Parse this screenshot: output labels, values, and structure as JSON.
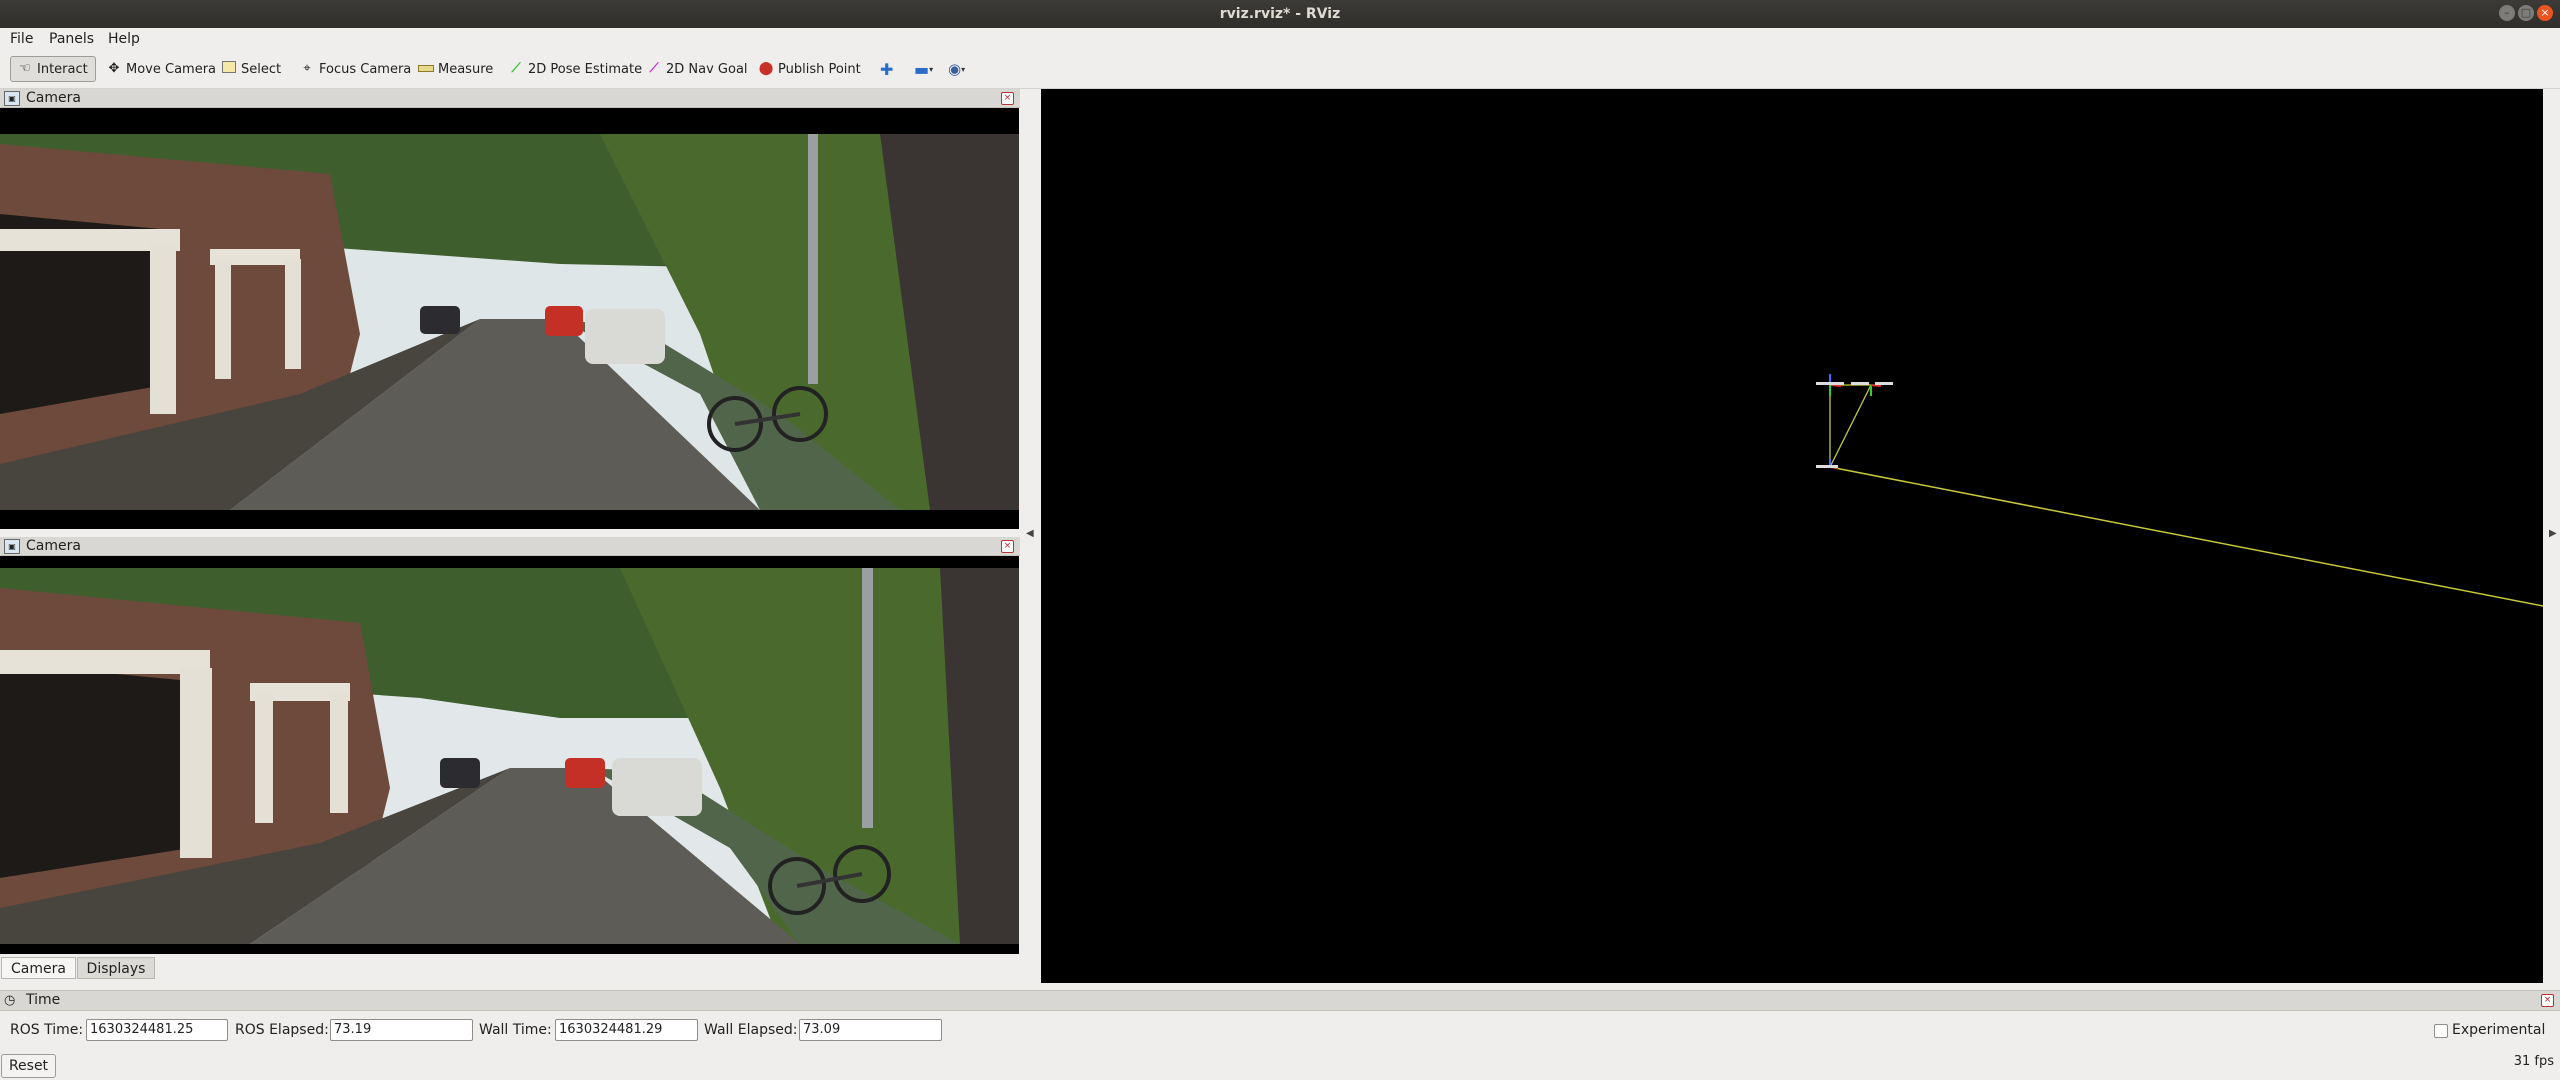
{
  "window": {
    "title": "rviz.rviz* - RViz"
  },
  "menubar": {
    "file": "File",
    "panels": "Panels",
    "help": "Help"
  },
  "toolbar": {
    "interact": "Interact",
    "move_camera": "Move Camera",
    "select": "Select",
    "focus_camera": "Focus Camera",
    "measure": "Measure",
    "pose_estimate": "2D Pose Estimate",
    "nav_goal": "2D Nav Goal",
    "publish_point": "Publish Point"
  },
  "panels": {
    "camera_top_title": "Camera",
    "camera_bottom_title": "Camera"
  },
  "tabs": {
    "camera": "Camera",
    "displays": "Displays"
  },
  "time_panel": {
    "title": "Time",
    "ros_time_label": "ROS Time:",
    "ros_time": "1630324481.25",
    "ros_elapsed_label": "ROS Elapsed:",
    "ros_elapsed": "73.19",
    "wall_time_label": "Wall Time:",
    "wall_time": "1630324481.29",
    "wall_elapsed_label": "Wall Elapsed:",
    "wall_elapsed": "73.09",
    "experimental_label": "Experimental",
    "experimental_checked": false
  },
  "reset_label": "Reset",
  "fps": "31 fps",
  "colors": {
    "titlebar": "#3c3b37",
    "close": "#e95420",
    "viewport": "#000000",
    "frame_line": "#c8c83a"
  }
}
